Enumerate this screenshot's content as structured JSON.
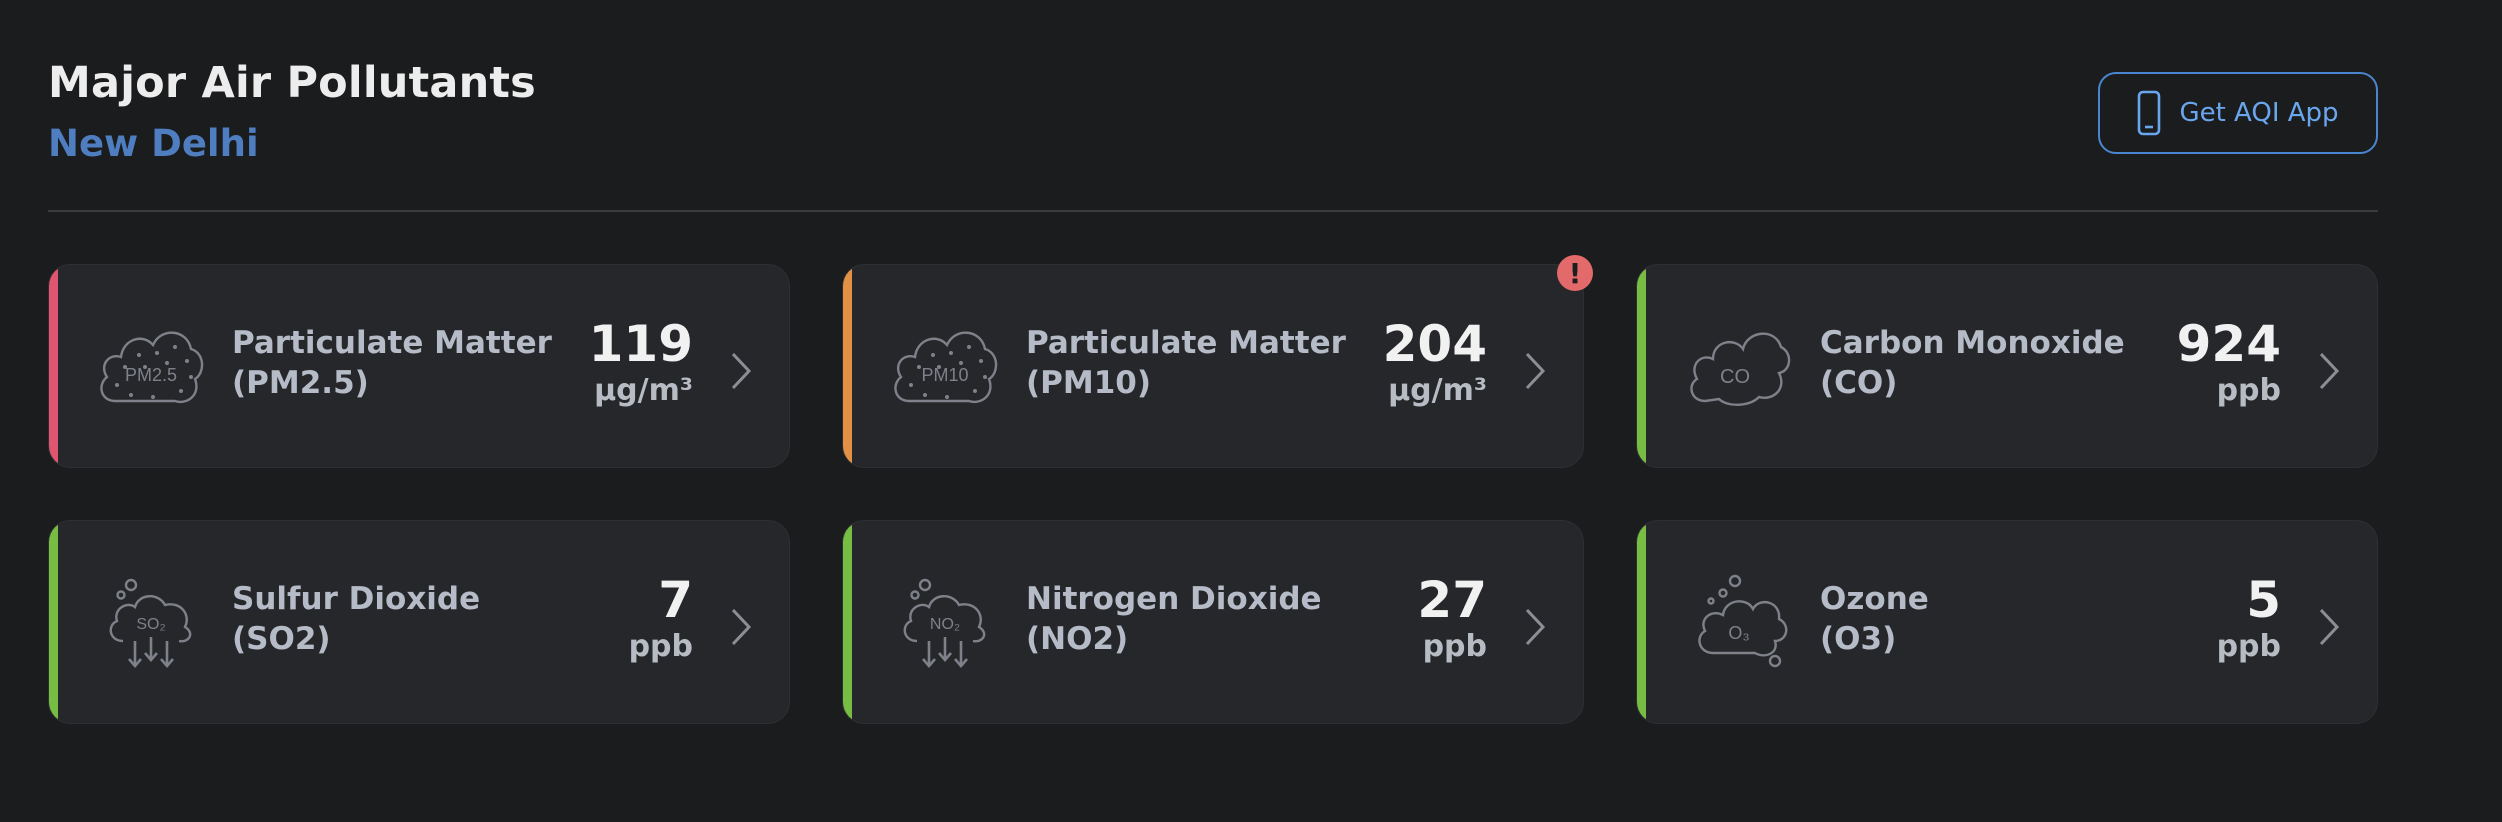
{
  "header": {
    "title": "Major Air Pollutants",
    "city": "New Delhi",
    "app_button": "Get AQI App"
  },
  "pollutants": [
    {
      "name": "Particulate Matter",
      "code": "(PM2.5)",
      "value": "119",
      "unit": "µg/m³",
      "icon": "pm25-cloud-icon",
      "icon_label": "PM2.5",
      "status_color": "#e0556f"
    },
    {
      "name": "Particulate Matter",
      "code": "(PM10)",
      "value": "204",
      "unit": "µg/m³",
      "icon": "pm10-cloud-icon",
      "icon_label": "PM10",
      "status_color": "#e39245",
      "alert": "!"
    },
    {
      "name": "Carbon Monoxide",
      "code": "(CO)",
      "value": "924",
      "unit": "ppb",
      "icon": "co-cloud-icon",
      "icon_label": "CO",
      "status_color": "#78bd43"
    },
    {
      "name": "Sulfur Dioxide",
      "code": "(SO2)",
      "value": "7",
      "unit": "ppb",
      "icon": "so2-cloud-icon",
      "icon_label": "SO₂",
      "status_color": "#78bd43"
    },
    {
      "name": "Nitrogen Dioxide",
      "code": "(NO2)",
      "value": "27",
      "unit": "ppb",
      "icon": "no2-cloud-icon",
      "icon_label": "NO₂",
      "status_color": "#78bd43"
    },
    {
      "name": "Ozone",
      "code": "(O3)",
      "value": "5",
      "unit": "ppb",
      "icon": "o3-cloud-icon",
      "icon_label": "O₃",
      "status_color": "#78bd43"
    }
  ]
}
